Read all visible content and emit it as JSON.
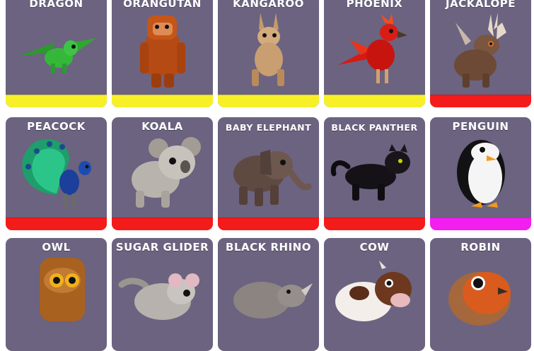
{
  "colors": {
    "card_bg": "#6b6380",
    "rarity_yellow": "#f7f029",
    "rarity_red": "#f41b1b",
    "rarity_magenta": "#f21ff0"
  },
  "pets": [
    {
      "name": "DRAGON",
      "rarity_color": "#f7f029",
      "icon": "dragon-icon"
    },
    {
      "name": "ORANGUTAN",
      "rarity_color": "#f7f029",
      "icon": "orangutan-icon"
    },
    {
      "name": "KANGAROO",
      "rarity_color": "#f7f029",
      "icon": "kangaroo-icon"
    },
    {
      "name": "PHOENIX",
      "rarity_color": "#f7f029",
      "icon": "phoenix-icon"
    },
    {
      "name": "JACKALOPE",
      "rarity_color": "#f41b1b",
      "icon": "jackalope-icon"
    },
    {
      "name": "PEACOCK",
      "rarity_color": "#f41b1b",
      "icon": "peacock-icon"
    },
    {
      "name": "KOALA",
      "rarity_color": "#f41b1b",
      "icon": "koala-icon"
    },
    {
      "name": "BABY ELEPHANT",
      "rarity_color": "#f41b1b",
      "icon": "baby-elephant-icon"
    },
    {
      "name": "BLACK PANTHER",
      "rarity_color": "#f41b1b",
      "icon": "black-panther-icon"
    },
    {
      "name": "PENGUIN",
      "rarity_color": "#f21ff0",
      "icon": "penguin-icon"
    },
    {
      "name": "OWL",
      "rarity_color": "",
      "icon": "owl-icon"
    },
    {
      "name": "SUGAR GLIDER",
      "rarity_color": "",
      "icon": "sugar-glider-icon"
    },
    {
      "name": "BLACK RHINO",
      "rarity_color": "",
      "icon": "black-rhino-icon"
    },
    {
      "name": "COW",
      "rarity_color": "",
      "icon": "cow-icon"
    },
    {
      "name": "ROBIN",
      "rarity_color": "",
      "icon": "robin-icon"
    }
  ]
}
